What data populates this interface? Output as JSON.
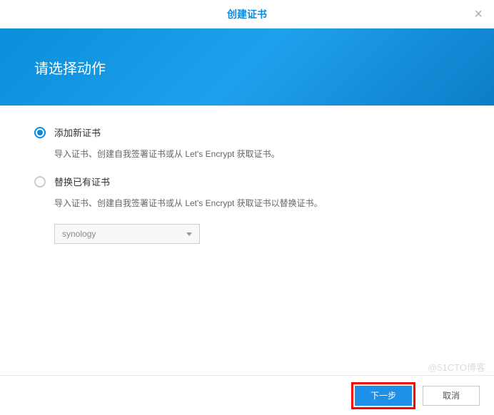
{
  "dialog": {
    "title": "创建证书",
    "close_label": "×"
  },
  "banner": {
    "heading": "请选择动作"
  },
  "options": {
    "add": {
      "label": "添加新证书",
      "desc": "导入证书、创建自我签署证书或从 Let's Encrypt 获取证书。",
      "checked": true
    },
    "replace": {
      "label": "替换已有证书",
      "desc": "导入证书、创建自我签署证书或从 Let's Encrypt 获取证书以替换证书。",
      "checked": false
    }
  },
  "select": {
    "value": "synology"
  },
  "footer": {
    "next": "下一步",
    "cancel": "取消"
  },
  "watermark": "@51CTO博客"
}
